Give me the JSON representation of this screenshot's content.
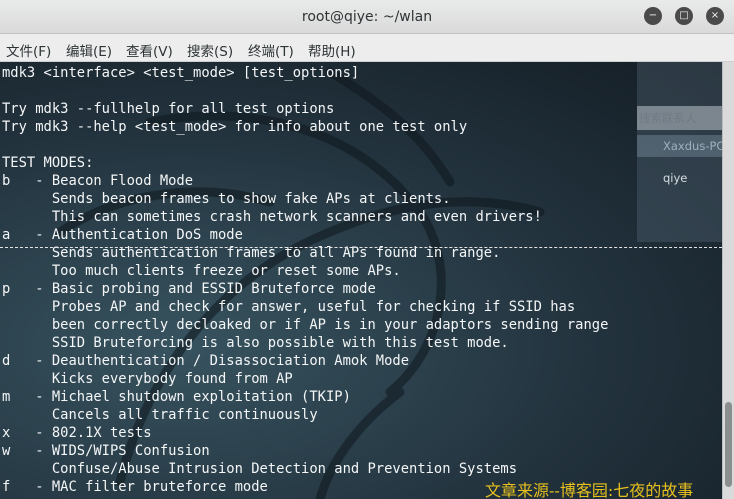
{
  "window": {
    "title": "root@qiye: ~/wlan"
  },
  "window_controls": {
    "minimize": "−",
    "maximize": "□",
    "close": "×"
  },
  "menu": [
    "文件(F)",
    "编辑(E)",
    "查看(V)",
    "搜索(S)",
    "终端(T)",
    "帮助(H)"
  ],
  "background_panel": {
    "search_label": "搜索联系人",
    "group_label": "Xaxdus-PC",
    "contact": "qiye"
  },
  "terminal_lines": [
    "mdk3 <interface> <test_mode> [test_options]",
    "",
    "Try mdk3 --fullhelp for all test options",
    "Try mdk3 --help <test_mode> for info about one test only",
    "",
    "TEST MODES:",
    "b   - Beacon Flood Mode",
    "      Sends beacon frames to show fake APs at clients.",
    "      This can sometimes crash network scanners and even drivers!",
    "a   - Authentication DoS mode",
    "      Sends authentication frames to all APs found in range.",
    "      Too much clients freeze or reset some APs.",
    "p   - Basic probing and ESSID Bruteforce mode",
    "      Probes AP and check for answer, useful for checking if SSID has",
    "      been correctly decloaked or if AP is in your adaptors sending range",
    "      SSID Bruteforcing is also possible with this test mode.",
    "d   - Deauthentication / Disassociation Amok Mode",
    "      Kicks everybody found from AP",
    "m   - Michael shutdown exploitation (TKIP)",
    "      Cancels all traffic continuously",
    "x   - 802.1X tests",
    "w   - WIDS/WIPS Confusion",
    "      Confuse/Abuse Intrusion Detection and Prevention Systems",
    "f   - MAC filter bruteforce mode"
  ],
  "watermark": "文章来源--博客园:七夜的故事",
  "colors": {
    "terminal_bg": "#22323d",
    "terminal_fg": "#f4f6f7",
    "titlebar": "#e9eaea",
    "watermark": "#e6c01e"
  }
}
